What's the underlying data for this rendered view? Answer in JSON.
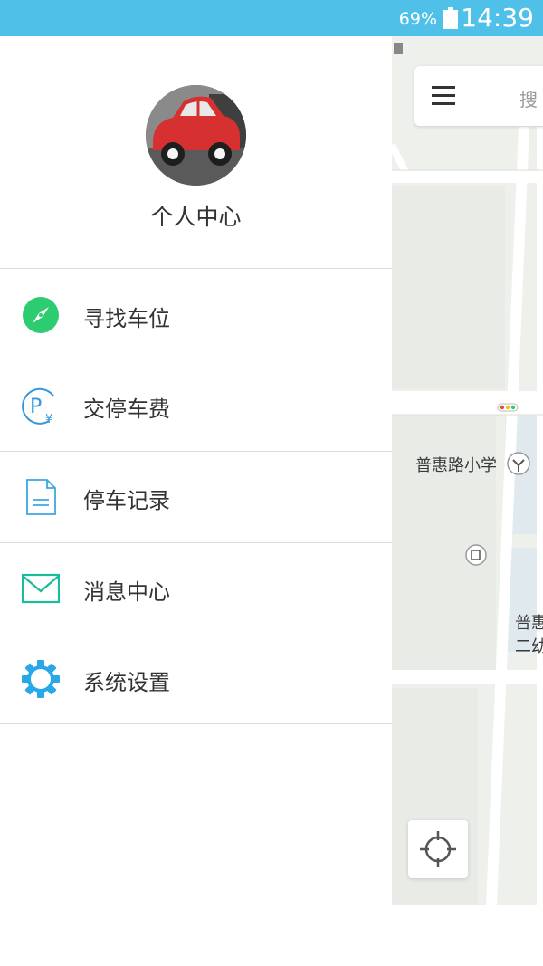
{
  "status_bar": {
    "battery_percent": "69%",
    "time": "14:39"
  },
  "drawer": {
    "profile_name": "个人中心",
    "menu": [
      {
        "label": "寻找车位",
        "icon": "compass-icon",
        "color": "#2ecc71"
      },
      {
        "label": "交停车费",
        "icon": "parking-fee-icon",
        "color": "#3498db"
      },
      {
        "label": "停车记录",
        "icon": "document-icon",
        "color": "#3aa8e0"
      },
      {
        "label": "消息中心",
        "icon": "mail-icon",
        "color": "#1abc9c"
      },
      {
        "label": "系统设置",
        "icon": "gear-icon",
        "color": "#29a8e8"
      }
    ]
  },
  "map": {
    "search_placeholder": "搜",
    "labels": {
      "school": "普惠路小学",
      "kindergarten_line1": "普惠",
      "kindergarten_line2": "二幼"
    }
  },
  "colors": {
    "status_bar": "#4fc1e9",
    "map_background": "#eef0ec",
    "road": "#ffffff"
  }
}
